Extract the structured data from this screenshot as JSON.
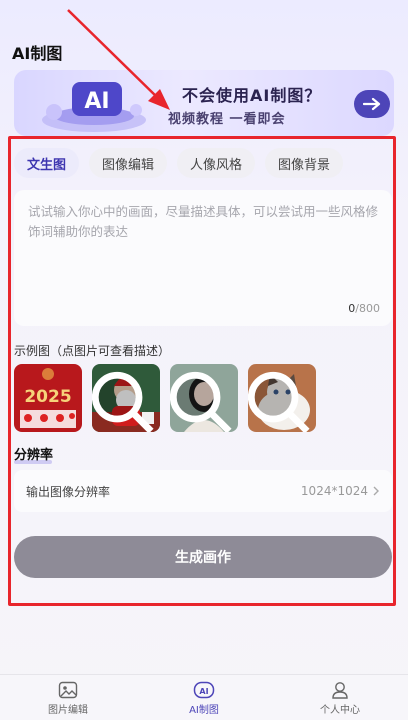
{
  "header": {
    "title": "AI制图"
  },
  "banner": {
    "title": "不会使用AI制图？",
    "subtitle": "视频教程 一看即会",
    "art_text": "AI",
    "arrow_icon": "arrow-right-icon"
  },
  "tabs": [
    {
      "label": "文生图",
      "active": true
    },
    {
      "label": "图像编辑",
      "active": false
    },
    {
      "label": "人像风格",
      "active": false
    },
    {
      "label": "图像背景",
      "active": false
    }
  ],
  "prompt": {
    "placeholder": "试试输入你心中的画面，尽量描述具体，可以尝试用一些风格修饰词辅助你的表达",
    "count": "0",
    "max": "/800"
  },
  "examples": {
    "label": "示例图（点图片可查看描述）",
    "items": [
      {
        "name": "new-year-2025",
        "text": "2025"
      },
      {
        "name": "santa-claus"
      },
      {
        "name": "girl-portrait"
      },
      {
        "name": "ragdoll-cat"
      }
    ]
  },
  "resolution": {
    "title": "分辨率",
    "label": "输出图像分辨率",
    "value": "1024*1024"
  },
  "generate_button": "生成画作",
  "bottom_nav": [
    {
      "label": "图片编辑",
      "icon": "image-icon",
      "active": false
    },
    {
      "label": "AI制图",
      "icon": "ai-icon",
      "icon_text": "AI",
      "active": true
    },
    {
      "label": "个人中心",
      "icon": "person-icon",
      "active": false
    }
  ],
  "colors": {
    "accent": "#4d45b8",
    "annotation_red": "#e8252c",
    "button_gray": "#8e8b97"
  }
}
